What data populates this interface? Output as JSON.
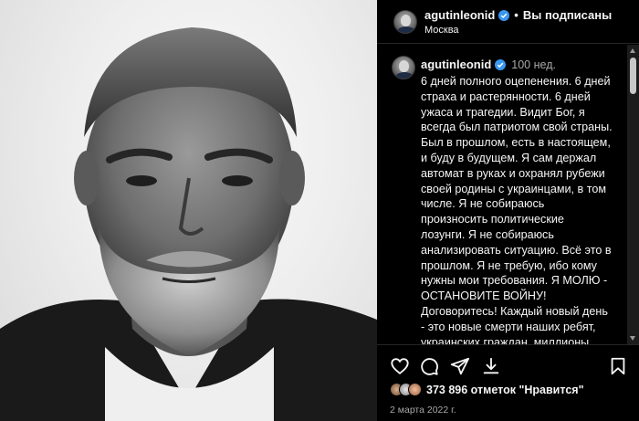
{
  "header": {
    "username": "agutinleonid",
    "separator": "•",
    "follow_status": "Вы подписаны",
    "location": "Москва"
  },
  "caption": {
    "username": "agutinleonid",
    "time": "100 нед.",
    "text": "6 дней полного оцепенения. 6 дней\nстраха и растерянности. 6 дней\nужаса и трагедии. Видит Бог, я\nвсегда был патриотом свой страны.\nБыл в прошлом, есть в настоящем,\nи буду в будущем. Я сам держал\nавтомат в руках и охранял рубежи\nсвоей родины с украинцами, в том\nчисле. Я не собираюсь\nпроизносить политические\nлозунги. Я не собираюсь\nанализировать ситуацию. Всё это в\nпрошлом. Я не требую, ибо кому\nнужны мои требования. Я МОЛЮ -\nОСТАНОВИТЕ ВОЙНУ!\nДоговоритесь! Каждый новый день\n- это новые смерти наших ребят,\nукраинских граждан, миллионы"
  },
  "actions": {
    "like_icon": "heart-icon",
    "comment_icon": "comment-icon",
    "share_icon": "share-icon",
    "download_icon": "download-icon",
    "save_icon": "bookmark-icon"
  },
  "likes": {
    "text": "373 896 отметок \"Нравится\""
  },
  "date": "2 марта 2022 г.",
  "colors": {
    "background": "#000000",
    "verified": "#3897f0",
    "secondary_text": "#a8a8a8",
    "divider": "#262626"
  }
}
